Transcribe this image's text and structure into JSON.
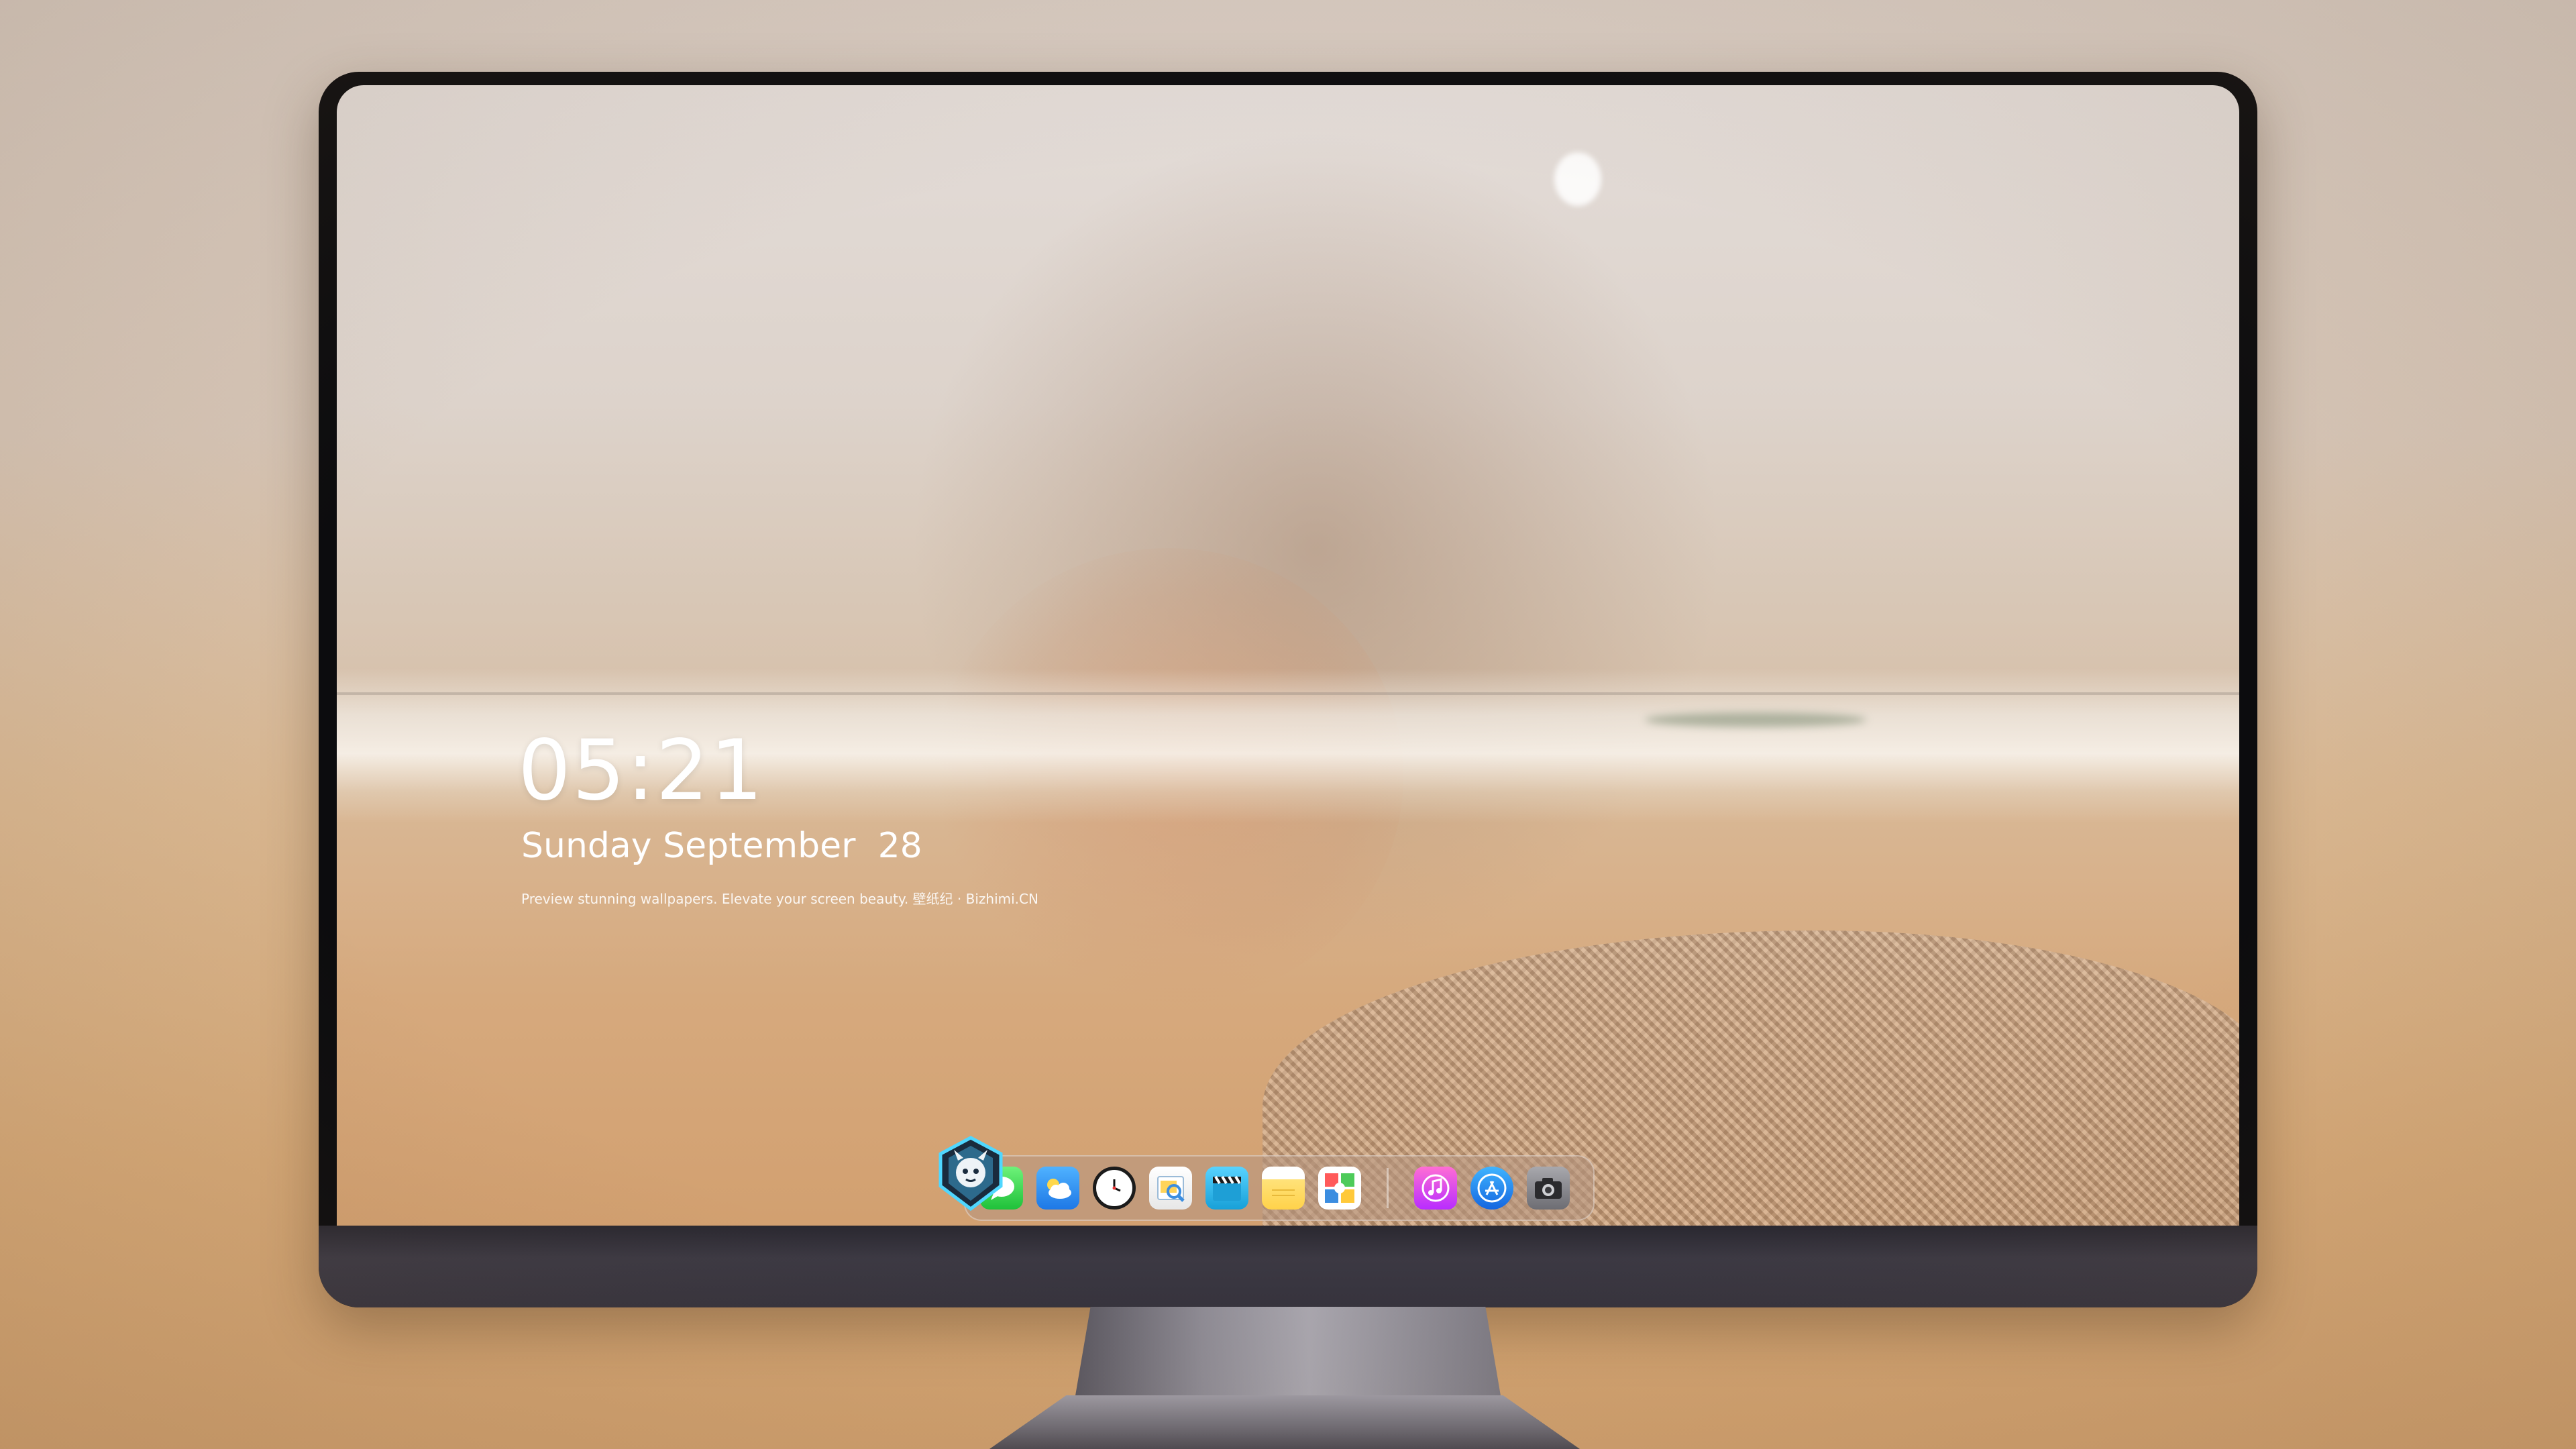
{
  "lock_screen": {
    "time": "05:21",
    "date": "Sunday September  28",
    "caption": "Preview stunning wallpapers. Elevate your screen beauty. 壁纸纪 · Bizhimi.CN"
  },
  "dock": {
    "apps": [
      {
        "name": "Messages",
        "icon": "messages-icon"
      },
      {
        "name": "Weather",
        "icon": "weather-icon"
      },
      {
        "name": "Clock",
        "icon": "clock-icon"
      },
      {
        "name": "Preview",
        "icon": "preview-icon"
      },
      {
        "name": "Video",
        "icon": "clapperboard-icon"
      },
      {
        "name": "Notes",
        "icon": "notes-icon"
      },
      {
        "name": "Photos",
        "icon": "photos-icon"
      },
      {
        "name": "Music",
        "icon": "music-icon"
      },
      {
        "name": "App Store",
        "icon": "app-store-icon"
      },
      {
        "name": "Camera",
        "icon": "camera-icon"
      }
    ]
  },
  "colors": {
    "clock_text": "#ffffff",
    "bezel": "#3a3741",
    "dock_background": "#b4968280"
  }
}
